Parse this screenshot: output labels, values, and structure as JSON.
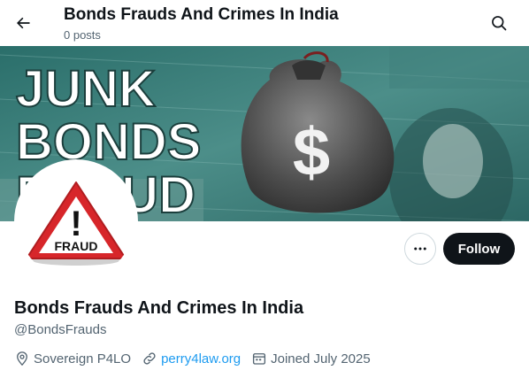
{
  "header": {
    "title": "Bonds Frauds And Crimes In India",
    "post_count": "0 posts"
  },
  "banner": {
    "line1": "JUNK",
    "line2": "BONDS",
    "line3": "FRAUD",
    "bag_symbol": "$",
    "colors": {
      "bill_green": "#2f7c78",
      "bag": "#5b5b5b"
    }
  },
  "avatar": {
    "warning_text": "FRAUD",
    "mark": "!",
    "colors": {
      "triangle_border": "#d7262a",
      "triangle_fill": "#ffffff"
    }
  },
  "actions": {
    "follow_label": "Follow"
  },
  "profile": {
    "display_name": "Bonds Frauds And Crimes In India",
    "handle": "@BondsFrauds",
    "location": "Sovereign P4LO",
    "website": "perry4law.org",
    "joined": "Joined July 2025"
  },
  "colors": {
    "text_primary": "#0f1419",
    "text_secondary": "#536471",
    "link": "#1d9bf0",
    "button_dark": "#0f1419"
  },
  "icons": {
    "back": "arrow-left-icon",
    "search": "search-icon",
    "more": "more-horizontal-icon",
    "location": "location-pin-icon",
    "link": "link-icon",
    "calendar": "calendar-icon"
  }
}
